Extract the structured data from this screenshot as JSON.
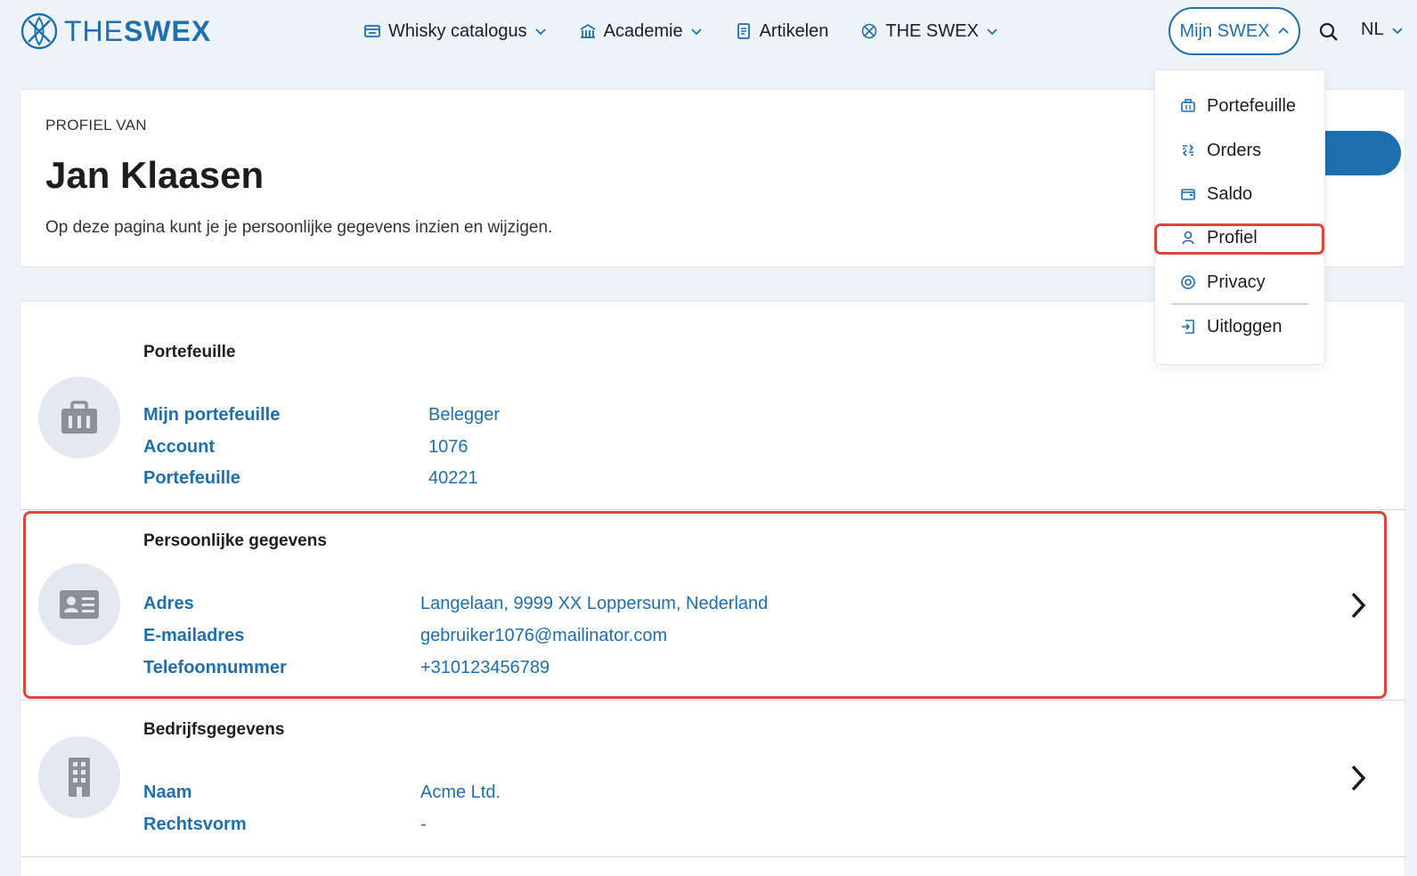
{
  "brand": {
    "thin": "THE",
    "bold": "SWEX"
  },
  "nav": [
    {
      "label": "Whisky catalogus",
      "icon": "catalog-icon",
      "has_dropdown": true
    },
    {
      "label": "Academie",
      "icon": "academy-icon",
      "has_dropdown": true
    },
    {
      "label": "Artikelen",
      "icon": "articles-icon",
      "has_dropdown": false
    },
    {
      "label": "THE SWEX",
      "icon": "swex-icon",
      "has_dropdown": true
    }
  ],
  "account_button": {
    "label": "Mijn SWEX",
    "expanded": true
  },
  "language": {
    "selected": "NL"
  },
  "profile": {
    "subtitle": "PROFIEL VAN",
    "name": "Jan Klaasen",
    "description": "Op deze pagina kunt je je persoonlijke gegevens inzien en wijzigen."
  },
  "sections": {
    "portefeuille": {
      "title": "Portefeuille",
      "icon": "briefcase-icon",
      "rows": [
        {
          "label": "Mijn portefeuille",
          "value": "Belegger"
        },
        {
          "label": "Account",
          "value": "1076"
        },
        {
          "label": "Portefeuille",
          "value": "40221"
        }
      ]
    },
    "persoonlijk": {
      "title": "Persoonlijke gegevens",
      "icon": "id-card-icon",
      "rows": [
        {
          "label": "Adres",
          "value": "Langelaan, 9999 XX Loppersum, Nederland"
        },
        {
          "label": "E-mailadres",
          "value": "gebruiker1076@mailinator.com"
        },
        {
          "label": "Telefoonnummer",
          "value": "+310123456789"
        }
      ]
    },
    "bedrijf": {
      "title": "Bedrijfsgegevens",
      "icon": "building-icon",
      "rows": [
        {
          "label": "Naam",
          "value": "Acme Ltd."
        },
        {
          "label": "Rechtsvorm",
          "value": "-"
        }
      ]
    }
  },
  "dropdown": {
    "items": [
      {
        "label": "Portefeuille",
        "icon": "briefcase-icon"
      },
      {
        "label": "Orders",
        "icon": "orders-icon"
      },
      {
        "label": "Saldo",
        "icon": "wallet-icon"
      },
      {
        "label": "Profiel",
        "icon": "user-icon"
      },
      {
        "label": "Privacy",
        "icon": "eye-icon"
      },
      {
        "label": "Uitloggen",
        "icon": "logout-icon"
      }
    ]
  },
  "colors": {
    "brand_blue": "#1d6fae",
    "highlight_red": "#d9473a",
    "page_bg": "#eef3f7"
  }
}
